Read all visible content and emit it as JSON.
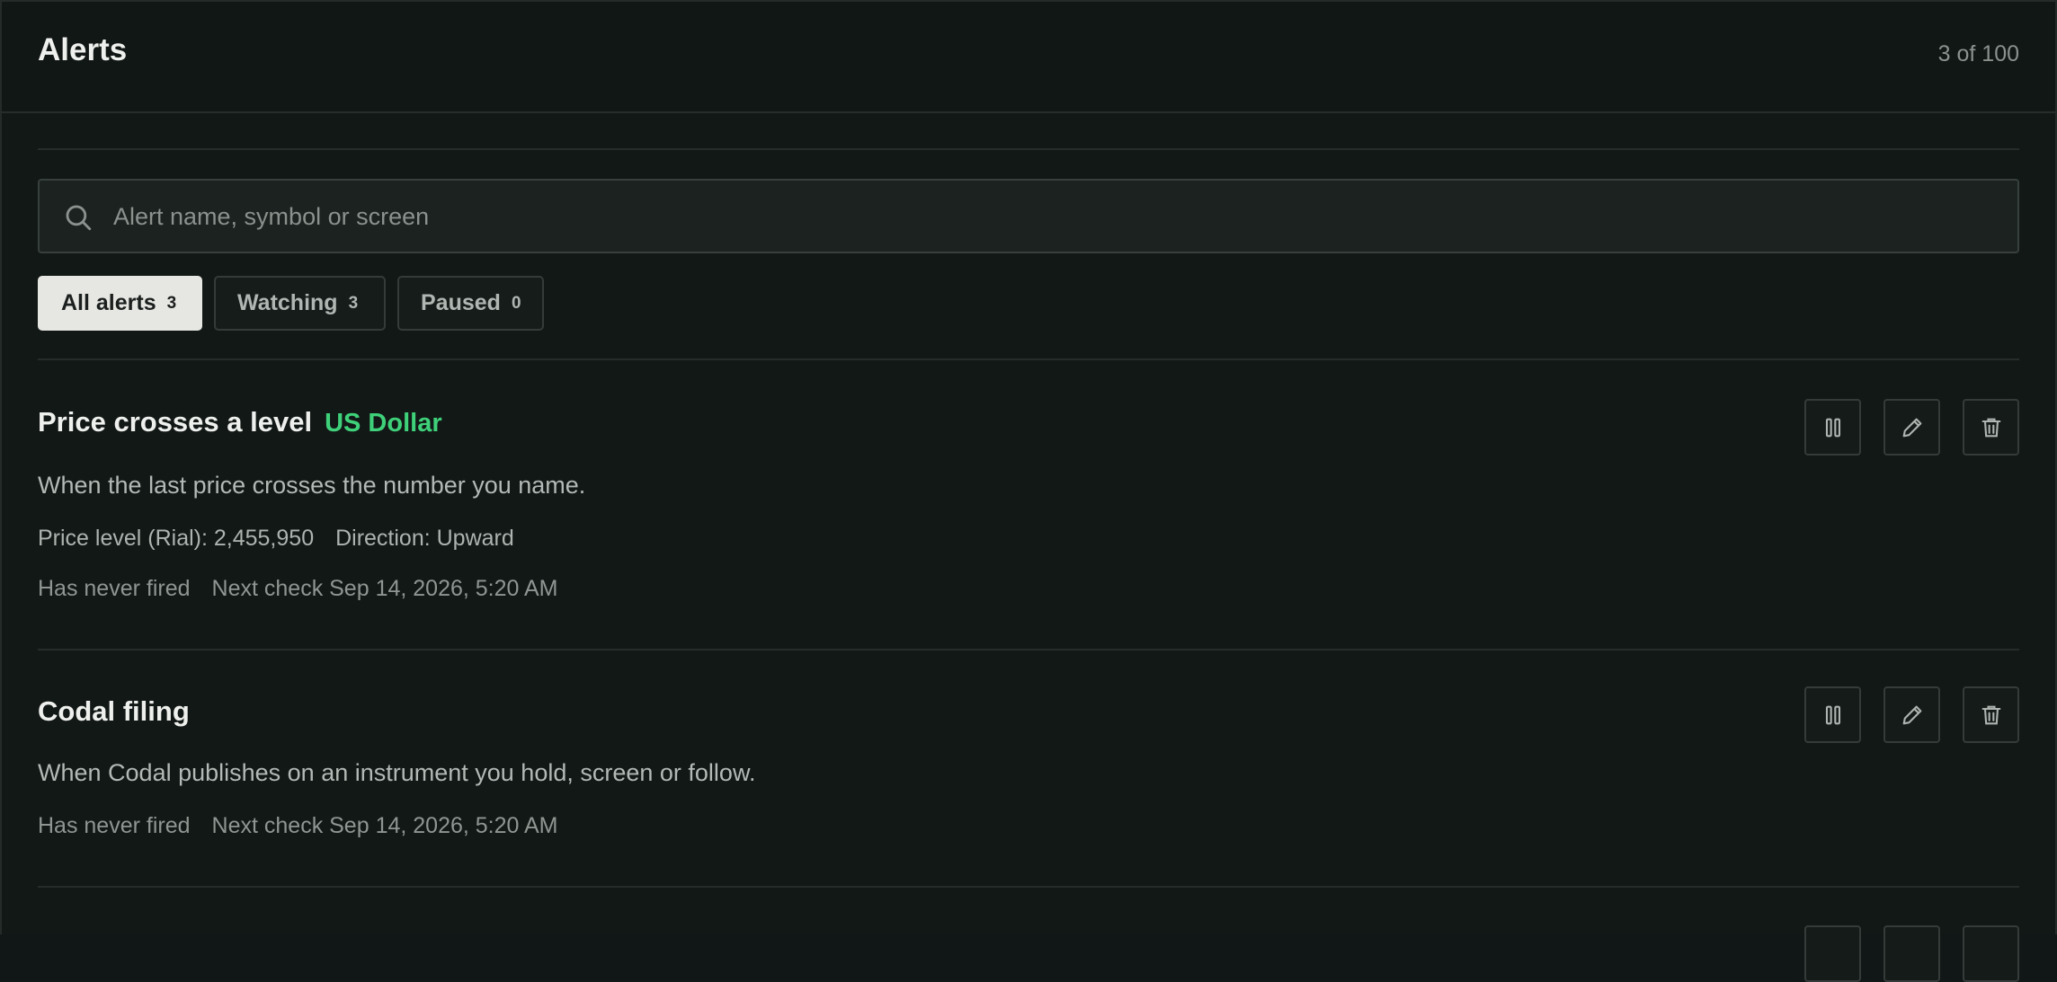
{
  "header": {
    "title": "Alerts",
    "count": "3 of 100"
  },
  "search": {
    "placeholder": "Alert name, symbol or screen",
    "value": ""
  },
  "tabs": [
    {
      "label": "All alerts",
      "count": "3",
      "active": true
    },
    {
      "label": "Watching",
      "count": "3",
      "active": false
    },
    {
      "label": "Paused",
      "count": "0",
      "active": false
    }
  ],
  "alerts": [
    {
      "title": "Price crosses a level",
      "tag": "US Dollar",
      "description": "When the last price crosses the number you name.",
      "price_level": "Price level (Rial): 2,455,950",
      "direction": "Direction: Upward",
      "fired": "Has never fired",
      "next_check": "Next check Sep 14, 2026, 5:20 AM"
    },
    {
      "title": "Codal filing",
      "description": "When Codal publishes on an instrument you hold, screen or follow.",
      "fired": "Has never fired",
      "next_check": "Next check Sep 14, 2026, 5:20 AM"
    }
  ],
  "icons": {
    "search": "search-icon",
    "pause": "pause-icon",
    "edit": "pencil-icon",
    "delete": "trash-icon"
  },
  "colors": {
    "accent_tag": "#3fd07a",
    "background": "#121816"
  }
}
